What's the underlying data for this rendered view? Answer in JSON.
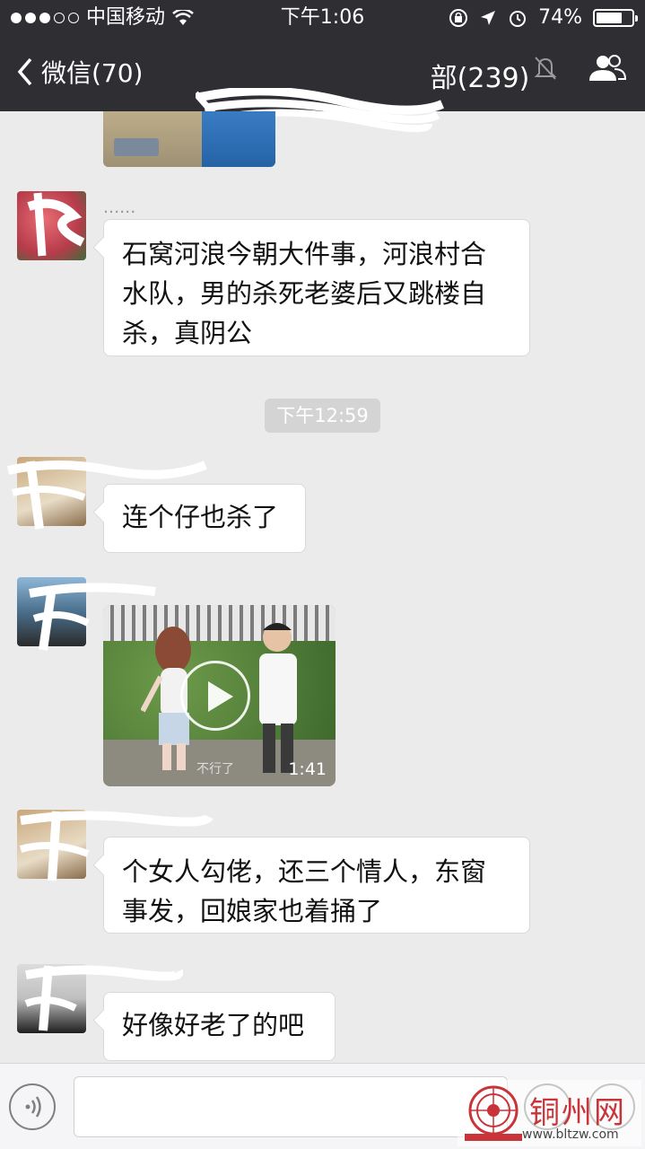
{
  "status_bar": {
    "carrier": "中国移动",
    "time": "下午1:06",
    "battery": "74%",
    "battery_level": 0.74
  },
  "nav": {
    "back_label": "微信(70)",
    "title": "部(239)"
  },
  "messages": {
    "m1_sender": "......",
    "m1_text_line1": "石窝河浪今朝大件事，河浪村合",
    "m1_text_line2": "水队，男的杀死老婆后又跳楼自",
    "m1_text_line3": "杀，真阴公",
    "timestamp": "下午12:59",
    "m2_text": "连个仔也杀了",
    "video_duration": "1:41",
    "video_caption": "不行了",
    "m4_text_line1": "个女人勾佬，还三个情人，东窗",
    "m4_text_line2": "事发，回娘家也着捅了",
    "m5_text": "好像好老了的吧"
  },
  "watermark": {
    "name": "铜州网",
    "url": "www.bltzw.com"
  },
  "colors": {
    "header_bg": "#2e2e33",
    "chat_bg": "#ebebeb",
    "bubble_bg": "#ffffff",
    "watermark_red": "#c8343a"
  }
}
